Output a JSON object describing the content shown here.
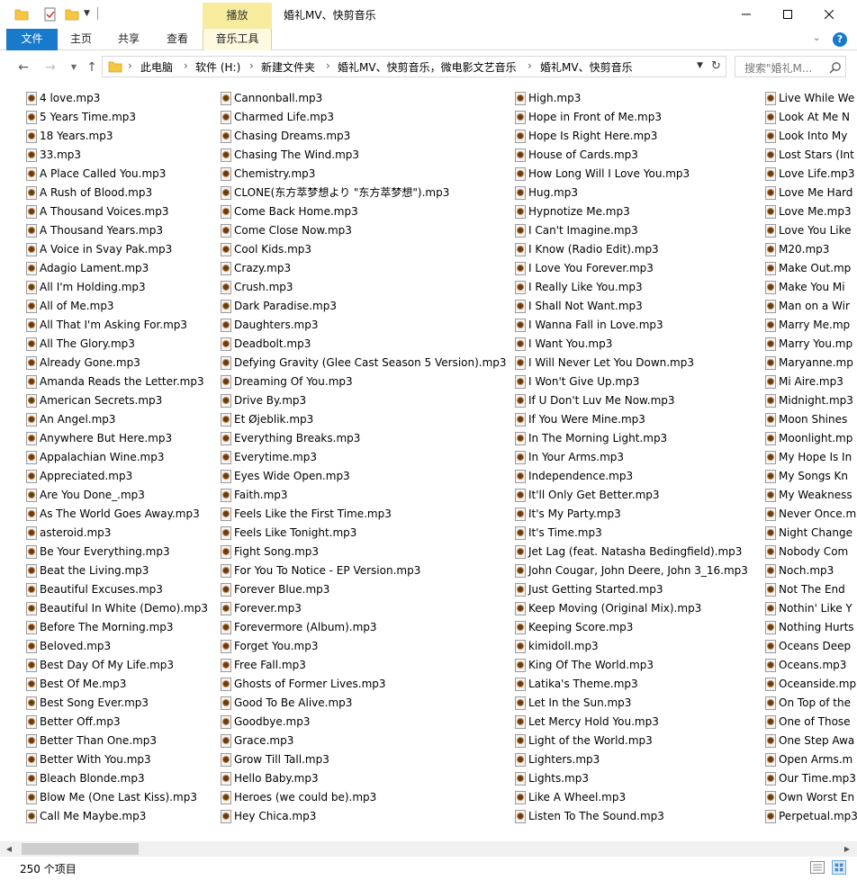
{
  "window": {
    "title": "婚礼MV、快剪音乐",
    "context_tab": "播放"
  },
  "ribbon": {
    "tabs": [
      {
        "label": "文件"
      },
      {
        "label": "主页"
      },
      {
        "label": "共享"
      },
      {
        "label": "查看"
      },
      {
        "label": "音乐工具"
      }
    ]
  },
  "address": {
    "crumbs": [
      "此电脑",
      "软件 (H:)",
      "新建文件夹",
      "婚礼MV、快剪音乐，微电影文艺音乐",
      "婚礼MV、快剪音乐"
    ]
  },
  "search": {
    "placeholder": "搜索\"婚礼M..."
  },
  "files": {
    "columns": [
      [
        "4 love.mp3",
        "5 Years Time.mp3",
        "18 Years.mp3",
        "33.mp3",
        "A Place Called You.mp3",
        "A Rush of Blood.mp3",
        "A Thousand Voices.mp3",
        "A Thousand Years.mp3",
        "A Voice in Svay Pak.mp3",
        "Adagio Lament.mp3",
        "All I'm Holding.mp3",
        "All of Me.mp3",
        "All That I'm Asking For.mp3",
        "All The Glory.mp3",
        "Already Gone.mp3",
        "Amanda Reads the Letter.mp3",
        "American Secrets.mp3",
        "An Angel.mp3",
        "Anywhere But Here.mp3",
        "Appalachian Wine.mp3",
        "Appreciated.mp3",
        "Are You Done_.mp3",
        "As The World Goes Away.mp3",
        "asteroid.mp3",
        "Be Your Everything.mp3",
        "Beat the Living.mp3",
        "Beautiful Excuses.mp3",
        "Beautiful In White (Demo).mp3",
        "Before The Morning.mp3",
        "Beloved.mp3",
        "Best Day Of My Life.mp3",
        "Best Of Me.mp3",
        "Best Song Ever.mp3",
        "Better Off.mp3",
        "Better Than One.mp3",
        "Better With You.mp3",
        "Bleach Blonde.mp3",
        "Blow Me (One Last Kiss).mp3",
        "Call Me Maybe.mp3"
      ],
      [
        "Cannonball.mp3",
        "Charmed Life.mp3",
        "Chasing Dreams.mp3",
        "Chasing The Wind.mp3",
        "Chemistry.mp3",
        "CLONE(东方萃梦想より \"东方萃梦想\").mp3",
        "Come Back Home.mp3",
        "Come Close Now.mp3",
        "Cool Kids.mp3",
        "Crazy.mp3",
        "Crush.mp3",
        "Dark Paradise.mp3",
        "Daughters.mp3",
        "Deadbolt.mp3",
        "Defying Gravity (Glee Cast Season 5 Version).mp3",
        "Dreaming Of You.mp3",
        "Drive By.mp3",
        "Et Øjeblik.mp3",
        "Everything Breaks.mp3",
        "Everytime.mp3",
        "Eyes Wide Open.mp3",
        "Faith.mp3",
        "Feels Like the First Time.mp3",
        "Feels Like Tonight.mp3",
        "Fight Song.mp3",
        "For You To Notice - EP Version.mp3",
        "Forever Blue.mp3",
        "Forever.mp3",
        "Forevermore (Album).mp3",
        "Forget You.mp3",
        "Free Fall.mp3",
        "Ghosts of Former Lives.mp3",
        "Good To Be Alive.mp3",
        "Goodbye.mp3",
        "Grace.mp3",
        "Grow Till Tall.mp3",
        "Hello Baby.mp3",
        "Heroes (we could be).mp3",
        "Hey Chica.mp3"
      ],
      [
        "High.mp3",
        "Hope in Front of Me.mp3",
        "Hope Is Right Here.mp3",
        "House of Cards.mp3",
        "How Long Will I Love You.mp3",
        "Hug.mp3",
        "Hypnotize Me.mp3",
        "I Can't Imagine.mp3",
        "I Know (Radio Edit).mp3",
        "I Love You Forever.mp3",
        "I Really Like You.mp3",
        "I Shall Not Want.mp3",
        "I Wanna Fall in Love.mp3",
        "I Want You.mp3",
        "I Will Never Let You Down.mp3",
        "I Won't Give Up.mp3",
        "If U Don't Luv Me Now.mp3",
        "If You Were Mine.mp3",
        "In The Morning Light.mp3",
        "In Your Arms.mp3",
        "Independence.mp3",
        "It'll Only Get Better.mp3",
        "It's My Party.mp3",
        "It's Time.mp3",
        "Jet Lag (feat. Natasha Bedingfield).mp3",
        "John Cougar, John Deere, John 3_16.mp3",
        "Just Getting Started.mp3",
        "Keep Moving (Original Mix).mp3",
        "Keeping Score.mp3",
        "kimidoll.mp3",
        "King Of The World.mp3",
        "Latika's Theme.mp3",
        "Let In the Sun.mp3",
        "Let Mercy Hold You.mp3",
        "Light of the World.mp3",
        "Lighters.mp3",
        "Lights.mp3",
        "Like A Wheel.mp3",
        "Listen To The Sound.mp3"
      ],
      [
        "Live While We",
        "Look At Me N",
        "Look Into My",
        "Lost Stars (Int",
        "Love Life.mp3",
        "Love Me Hard",
        "Love Me.mp3",
        "Love You Like",
        "M20.mp3",
        "Make Out.mp",
        "Make You Mi",
        "Man on a Wir",
        "Marry Me.mp",
        "Marry You.mp",
        "Maryanne.mp",
        "Mi Aire.mp3",
        "Midnight.mp3",
        "Moon Shines",
        "Moonlight.mp",
        "My Hope Is In",
        "My Songs Kn",
        "My Weakness",
        "Never Once.m",
        "Night Change",
        "Nobody Com",
        "Noch.mp3",
        "Not The End",
        "Nothin' Like Y",
        "Nothing Hurts",
        "Oceans Deep",
        "Oceans.mp3",
        "Oceanside.mp",
        "On Top of the",
        "One of Those",
        "One Step Awa",
        "Open Arms.m",
        "Our Time.mp3",
        "Own Worst En",
        "Perpetual.mp3"
      ]
    ]
  },
  "status": {
    "item_count": "250 个项目"
  }
}
